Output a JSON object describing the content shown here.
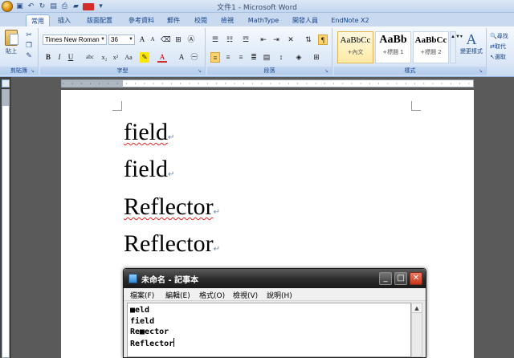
{
  "window": {
    "title": "文件1 - Microsoft Word"
  },
  "ribbon_tabs": [
    {
      "label": "常用",
      "active": true
    },
    {
      "label": "插入"
    },
    {
      "label": "版面配置"
    },
    {
      "label": "參考資料"
    },
    {
      "label": "郵件"
    },
    {
      "label": "校閱"
    },
    {
      "label": "檢視"
    },
    {
      "label": "MathType"
    },
    {
      "label": "開發人員"
    },
    {
      "label": "EndNote X2"
    }
  ],
  "groups": {
    "clipboard": {
      "label": "剪貼簿",
      "paste": "貼上"
    },
    "font": {
      "label": "字型",
      "font_name": "Times New Roman",
      "font_size": "36"
    },
    "paragraph": {
      "label": "段落"
    },
    "styles": {
      "label": "樣式",
      "items": [
        {
          "sample": "AaBbCc",
          "name": "+內文"
        },
        {
          "sample": "AaBb",
          "name": "+標題 1"
        },
        {
          "sample": "AaBbCc",
          "name": "+標題 2"
        }
      ],
      "change_styles": "變更樣式"
    },
    "editing": {
      "items": [
        "尋找",
        "取代",
        "選取"
      ]
    }
  },
  "document": {
    "lines": [
      {
        "text": "field",
        "misspelled": true
      },
      {
        "text": "field",
        "misspelled": false
      },
      {
        "text": "Reflector",
        "misspelled": true
      },
      {
        "text": "Reflector",
        "misspelled": false
      }
    ]
  },
  "notepad": {
    "title": "未命名 - 記事本",
    "menu": [
      "檔案(F)",
      "編輯(E)",
      "格式(O)",
      "檢視(V)",
      "說明(H)"
    ],
    "lines": [
      "■eld",
      "field",
      "Re■ector",
      "Reflector"
    ]
  }
}
